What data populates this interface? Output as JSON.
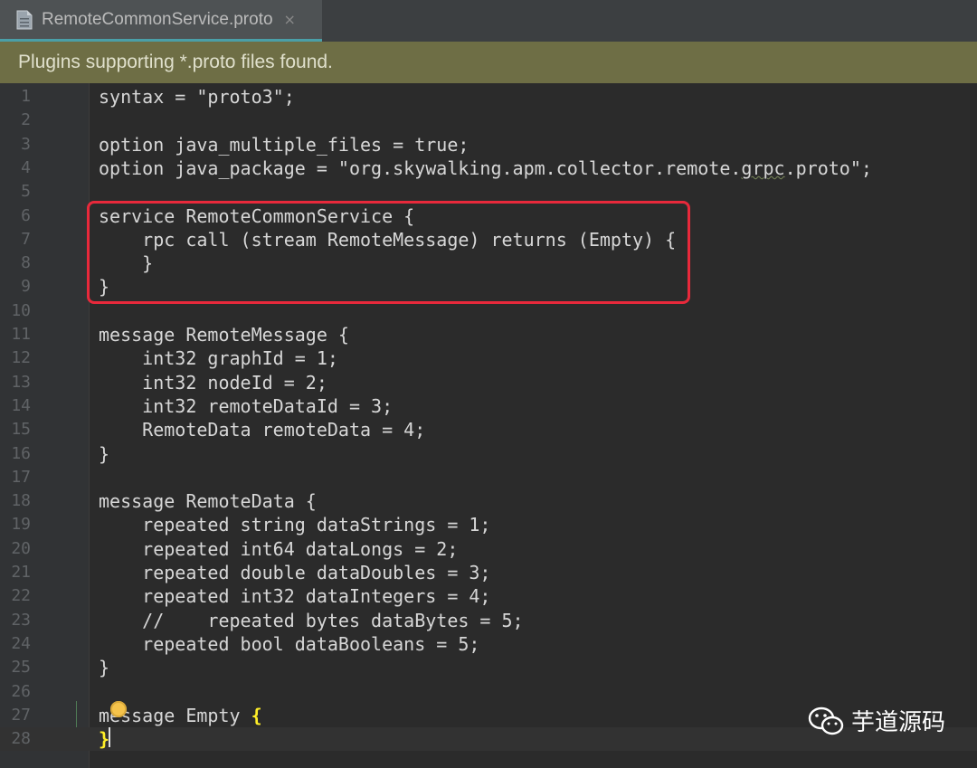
{
  "tab": {
    "title": "RemoteCommonService.proto",
    "close_glyph": "×",
    "icon": "file-icon"
  },
  "banner": {
    "text": "Plugins supporting *.proto files found."
  },
  "editor": {
    "lines": [
      {
        "n": "1",
        "text": "syntax = \"proto3\";"
      },
      {
        "n": "2",
        "text": ""
      },
      {
        "n": "3",
        "text": "option java_multiple_files = true;"
      },
      {
        "n": "4",
        "text": "option java_package = \"org.skywalking.apm.collector.remote.grpc.proto\";"
      },
      {
        "n": "5",
        "text": ""
      },
      {
        "n": "6",
        "text": "service RemoteCommonService {"
      },
      {
        "n": "7",
        "text": "    rpc call (stream RemoteMessage) returns (Empty) {"
      },
      {
        "n": "8",
        "text": "    }"
      },
      {
        "n": "9",
        "text": "}"
      },
      {
        "n": "10",
        "text": ""
      },
      {
        "n": "11",
        "text": "message RemoteMessage {"
      },
      {
        "n": "12",
        "text": "    int32 graphId = 1;"
      },
      {
        "n": "13",
        "text": "    int32 nodeId = 2;"
      },
      {
        "n": "14",
        "text": "    int32 remoteDataId = 3;"
      },
      {
        "n": "15",
        "text": "    RemoteData remoteData = 4;"
      },
      {
        "n": "16",
        "text": "}"
      },
      {
        "n": "17",
        "text": ""
      },
      {
        "n": "18",
        "text": "message RemoteData {"
      },
      {
        "n": "19",
        "text": "    repeated string dataStrings = 1;"
      },
      {
        "n": "20",
        "text": "    repeated int64 dataLongs = 2;"
      },
      {
        "n": "21",
        "text": "    repeated double dataDoubles = 3;"
      },
      {
        "n": "22",
        "text": "    repeated int32 dataIntegers = 4;"
      },
      {
        "n": "23",
        "text": "    //    repeated bytes dataBytes = 5;"
      },
      {
        "n": "24",
        "text": "    repeated bool dataBooleans = 5;"
      },
      {
        "n": "25",
        "text": "}"
      },
      {
        "n": "26",
        "text": ""
      },
      {
        "n": "27",
        "text": "message Empty {"
      },
      {
        "n": "28",
        "text": "}"
      }
    ],
    "highlight_color": "#e8293b",
    "brace_highlight_color": "#ffef28"
  },
  "watermark": {
    "text": "芋道源码",
    "icon": "wechat-icon"
  }
}
